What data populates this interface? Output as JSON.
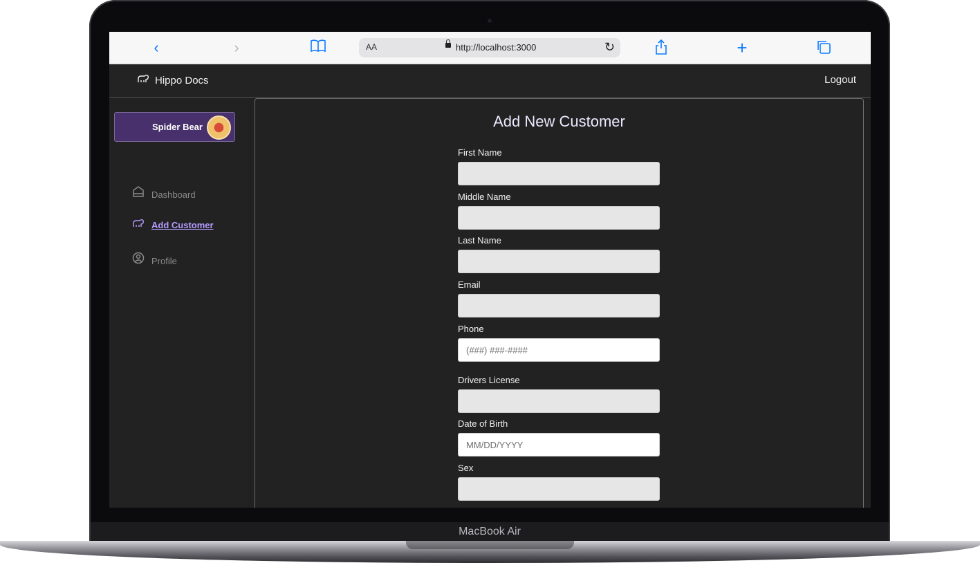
{
  "device": {
    "label": "MacBook Air"
  },
  "browser": {
    "aa_label": "AA",
    "url": "http://localhost:3000"
  },
  "app": {
    "brand": "Hippo Docs",
    "logout_label": "Logout"
  },
  "sidebar": {
    "user_name": "Spider Bear",
    "items": [
      {
        "label": "Dashboard",
        "icon": "home-icon"
      },
      {
        "label": "Add Customer",
        "icon": "hippo-icon",
        "active": true
      },
      {
        "label": "Profile",
        "icon": "user-circle-icon"
      }
    ]
  },
  "form": {
    "title": "Add New Customer",
    "fields": [
      {
        "label": "First Name",
        "placeholder": ""
      },
      {
        "label": "Middle Name",
        "placeholder": ""
      },
      {
        "label": "Last Name",
        "placeholder": ""
      },
      {
        "label": "Email",
        "placeholder": ""
      },
      {
        "label": "Phone",
        "placeholder": "(###) ###-####"
      },
      {
        "label": "Drivers License",
        "placeholder": ""
      },
      {
        "label": "Date of Birth",
        "placeholder": "MM/DD/YYYY"
      },
      {
        "label": "Sex",
        "placeholder": ""
      }
    ]
  },
  "colors": {
    "accent": "#b39bff",
    "user_card": "#47306b",
    "background": "#222222"
  }
}
